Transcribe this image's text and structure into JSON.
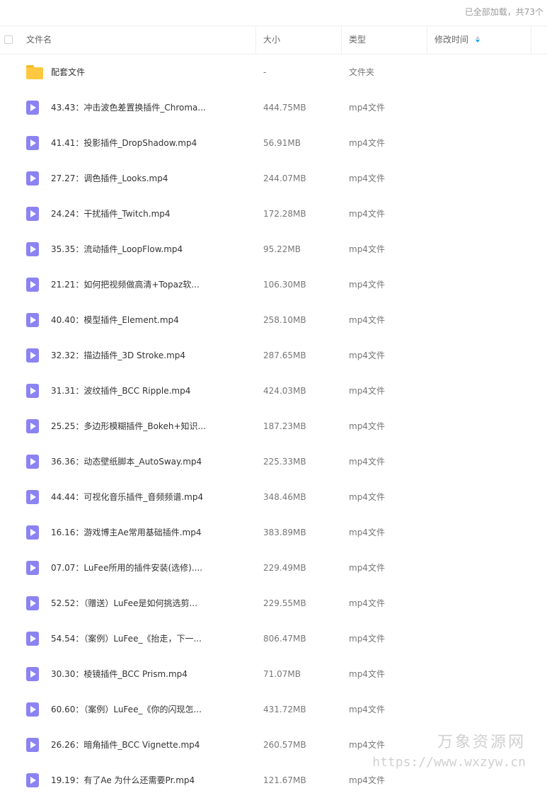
{
  "status": {
    "loaded_text": "已全部加载，共73个"
  },
  "header": {
    "name_label": "文件名",
    "size_label": "大小",
    "type_label": "类型",
    "modified_label": "修改时间"
  },
  "rows": [
    {
      "name": "配套文件",
      "size": "-",
      "type": "文件夹",
      "icon": "folder-icon"
    },
    {
      "name": "43.43：冲击波色差置换插件_Chroma...",
      "size": "444.75MB",
      "type": "mp4文件",
      "icon": "video-icon"
    },
    {
      "name": "41.41：投影插件_DropShadow.mp4",
      "size": "56.91MB",
      "type": "mp4文件",
      "icon": "video-icon"
    },
    {
      "name": "27.27：调色插件_Looks.mp4",
      "size": "244.07MB",
      "type": "mp4文件",
      "icon": "video-icon"
    },
    {
      "name": "24.24：干扰插件_Twitch.mp4",
      "size": "172.28MB",
      "type": "mp4文件",
      "icon": "video-icon"
    },
    {
      "name": "35.35：流动插件_LoopFlow.mp4",
      "size": "95.22MB",
      "type": "mp4文件",
      "icon": "video-icon"
    },
    {
      "name": "21.21：如何把视频做高清+Topaz软...",
      "size": "106.30MB",
      "type": "mp4文件",
      "icon": "video-icon"
    },
    {
      "name": "40.40：模型插件_Element.mp4",
      "size": "258.10MB",
      "type": "mp4文件",
      "icon": "video-icon"
    },
    {
      "name": "32.32：描边插件_3D Stroke.mp4",
      "size": "287.65MB",
      "type": "mp4文件",
      "icon": "video-icon"
    },
    {
      "name": "31.31：波纹插件_BCC Ripple.mp4",
      "size": "424.03MB",
      "type": "mp4文件",
      "icon": "video-icon"
    },
    {
      "name": "25.25：多边形模糊插件_Bokeh+知识...",
      "size": "187.23MB",
      "type": "mp4文件",
      "icon": "video-icon"
    },
    {
      "name": "36.36：动态壁纸脚本_AutoSway.mp4",
      "size": "225.33MB",
      "type": "mp4文件",
      "icon": "video-icon"
    },
    {
      "name": "44.44：可视化音乐插件_音频频谱.mp4",
      "size": "348.46MB",
      "type": "mp4文件",
      "icon": "video-icon"
    },
    {
      "name": "16.16：游戏博主Ae常用基础插件.mp4",
      "size": "383.89MB",
      "type": "mp4文件",
      "icon": "video-icon"
    },
    {
      "name": "07.07：LuFee所用的插件安装(选修)....",
      "size": "229.49MB",
      "type": "mp4文件",
      "icon": "video-icon"
    },
    {
      "name": "52.52：（赠送）LuFee是如何挑选剪...",
      "size": "229.55MB",
      "type": "mp4文件",
      "icon": "video-icon"
    },
    {
      "name": "54.54：（案例）LuFee_《抬走，下一...",
      "size": "806.47MB",
      "type": "mp4文件",
      "icon": "video-icon"
    },
    {
      "name": "30.30：棱镜插件_BCC Prism.mp4",
      "size": "71.07MB",
      "type": "mp4文件",
      "icon": "video-icon"
    },
    {
      "name": "60.60：（案例）LuFee_《你的闪现怎...",
      "size": "431.72MB",
      "type": "mp4文件",
      "icon": "video-icon"
    },
    {
      "name": "26.26：暗角插件_BCC Vignette.mp4",
      "size": "260.57MB",
      "type": "mp4文件",
      "icon": "video-icon"
    },
    {
      "name": "19.19：有了Ae 为什么还需要Pr.mp4",
      "size": "121.67MB",
      "type": "mp4文件",
      "icon": "video-icon"
    }
  ],
  "watermark": {
    "title": "万象资源网",
    "url": "https://www.wxzyw.cn"
  },
  "colors": {
    "accent": "#06a7ff",
    "video_icon": "#8c83f2",
    "folder_icon": "#ffc840"
  }
}
